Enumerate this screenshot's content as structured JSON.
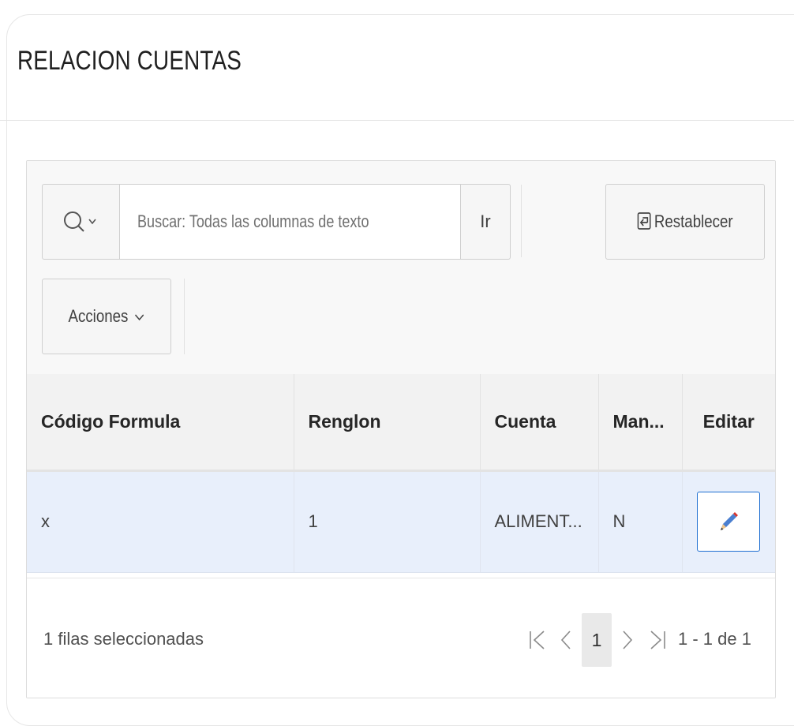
{
  "page": {
    "title": "RELACION CUENTAS"
  },
  "toolbar": {
    "search_placeholder": "Buscar: Todas las columnas de texto",
    "go_label": "Ir",
    "reset_label": "Restablecer",
    "actions_label": "Acciones"
  },
  "table": {
    "columns": [
      "Código Formula",
      "Renglon",
      "Cuenta",
      "Man...",
      "Editar"
    ],
    "rows": [
      {
        "codigo": "x",
        "renglon": "1",
        "cuenta": "ALIMENT...",
        "man": "N"
      }
    ]
  },
  "footer": {
    "selected_text": "1 filas seleccionadas",
    "current_page": "1",
    "range_text": "1 - 1 de 1"
  },
  "colors": {
    "accent": "#1f6fd1",
    "row_selected": "#e8effb",
    "pencil_tip": "#d9342b"
  },
  "icons": [
    "search-icon",
    "chevron-down-icon",
    "reset-icon",
    "pencil-icon",
    "first-page-icon",
    "previous-page-icon",
    "next-page-icon",
    "last-page-icon"
  ]
}
